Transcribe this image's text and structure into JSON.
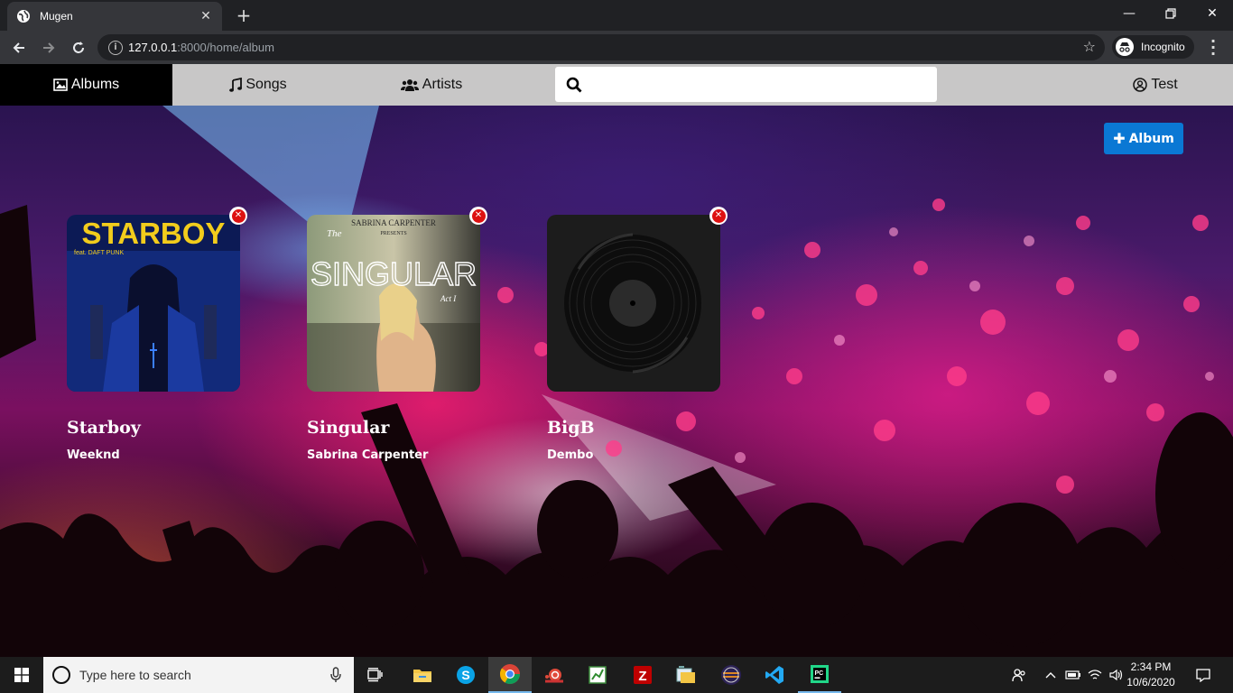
{
  "browser": {
    "tab_title": "Mugen",
    "url_host": "127.0.0.1",
    "url_path": ":8000/home/album",
    "incognito_label": "Incognito"
  },
  "nav": {
    "albums": "Albums",
    "songs": "Songs",
    "artists": "Artists",
    "user": "Test",
    "search_placeholder": ""
  },
  "page": {
    "add_album_label": "Album",
    "albums": [
      {
        "title": "Starboy",
        "artist": "Weeknd",
        "cover_text": "STARBOY",
        "cover_sub": "feat. DAFT PUNK"
      },
      {
        "title": "Singular",
        "artist": "Sabrina Carpenter",
        "cover_text": "SINGULAR",
        "cover_sub": "SABRINA CARPENTER",
        "cover_pre": "The",
        "cover_presents": "PRESENTS",
        "cover_act": "Act I"
      },
      {
        "title": "BigB",
        "artist": "Dembo"
      }
    ]
  },
  "taskbar": {
    "search_placeholder": "Type here to search",
    "time": "2:34 PM",
    "date": "10/6/2020"
  },
  "colors": {
    "accent": "#0a78d4",
    "nav_bg": "#c8c7c7",
    "remove_red": "#dd1111"
  }
}
